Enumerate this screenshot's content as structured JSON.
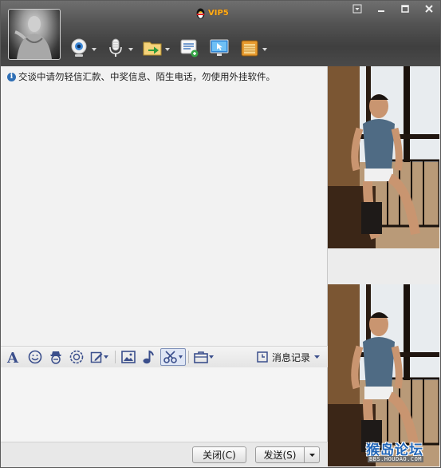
{
  "window": {
    "title_badge": "VIP5",
    "controls": [
      "menu",
      "minimize",
      "maximize",
      "close"
    ]
  },
  "toolbar": {
    "items": [
      {
        "name": "webcam-icon",
        "has_dropdown": true
      },
      {
        "name": "microphone-icon",
        "has_dropdown": true
      },
      {
        "name": "send-file-icon",
        "has_dropdown": true
      },
      {
        "name": "create-discussion-icon",
        "has_dropdown": false
      },
      {
        "name": "remote-assist-icon",
        "has_dropdown": false
      },
      {
        "name": "app-box-icon",
        "has_dropdown": true
      }
    ]
  },
  "chat": {
    "notice": "交谈中请勿轻信汇款、中奖信息、陌生电话，勿使用外挂软件。"
  },
  "format_toolbar": {
    "history_label": "消息记录"
  },
  "buttons": {
    "close_label": "关闭(C)",
    "send_label": "发送(S)"
  },
  "watermark": {
    "line1": "猴岛论坛",
    "line2": "BBS.HOUDAO.COM"
  },
  "colors": {
    "titlebar": "#4a4a4a",
    "vip_badge": "#ffb018",
    "info_icon": "#2f6fb5"
  }
}
